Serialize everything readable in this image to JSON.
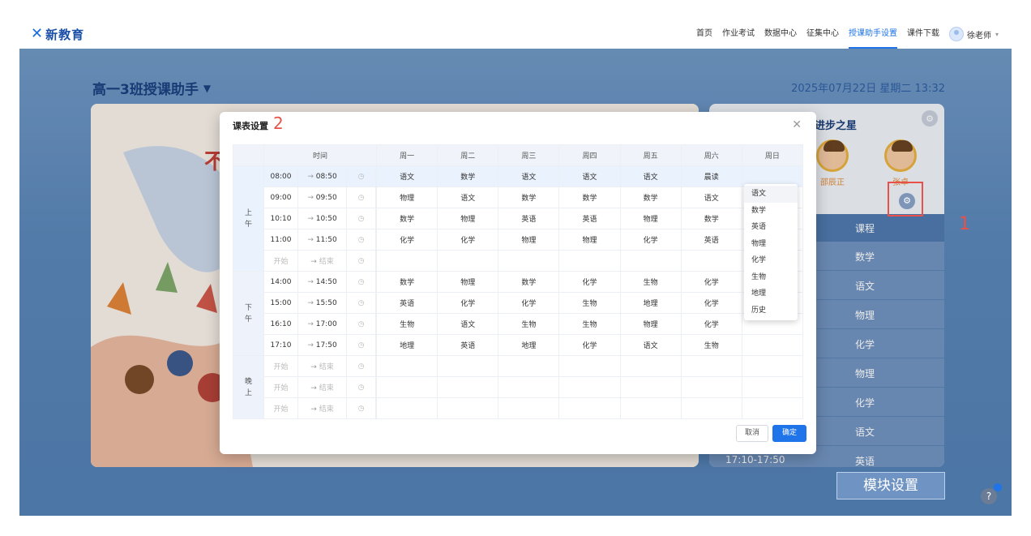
{
  "header": {
    "logo_text": "新教育",
    "nav": [
      "首页",
      "作业考试",
      "数据中心",
      "征集中心",
      "授课助手设置",
      "课件下载"
    ],
    "active_nav": "授课助手设置",
    "user_name": "徐老师"
  },
  "page": {
    "class_title": "高一3班授课助手",
    "datetime": "2025年07月22日 星期二  13:32",
    "star_title": "进步之星",
    "students": [
      "邵辰正",
      "张卓"
    ],
    "schedule_header": "课程",
    "schedule_subjects": [
      "数学",
      "语文",
      "物理",
      "化学",
      "物理",
      "化学",
      "语文",
      "英语"
    ],
    "last_time": "17:10-17:50",
    "module_button": "模块设置",
    "help": "?"
  },
  "annotations": {
    "one": "1",
    "two": "2"
  },
  "modal": {
    "title": "课表设置",
    "headers": {
      "time": "时间",
      "days": [
        "周一",
        "周二",
        "周三",
        "周四",
        "周五",
        "周六",
        "周日"
      ]
    },
    "periods": {
      "morning": "上\n午",
      "afternoon": "下\n午",
      "evening": "晚\n上"
    },
    "rows": [
      {
        "start": "08:00",
        "end": "08:50",
        "cells": [
          "语文",
          "数学",
          "语文",
          "语文",
          "语文",
          "晨读",
          ""
        ]
      },
      {
        "start": "09:00",
        "end": "09:50",
        "cells": [
          "物理",
          "语文",
          "数学",
          "数学",
          "数学",
          "语文",
          ""
        ]
      },
      {
        "start": "10:10",
        "end": "10:50",
        "cells": [
          "数学",
          "物理",
          "英语",
          "英语",
          "物理",
          "数学",
          ""
        ]
      },
      {
        "start": "11:00",
        "end": "11:50",
        "cells": [
          "化学",
          "化学",
          "物理",
          "物理",
          "化学",
          "英语",
          ""
        ]
      },
      {
        "start": "开始",
        "end": "结束",
        "cells": [
          "",
          "",
          "",
          "",
          "",
          "",
          ""
        ],
        "placeholder": true
      },
      {
        "start": "14:00",
        "end": "14:50",
        "cells": [
          "数学",
          "物理",
          "数学",
          "化学",
          "生物",
          "化学",
          ""
        ]
      },
      {
        "start": "15:00",
        "end": "15:50",
        "cells": [
          "英语",
          "化学",
          "化学",
          "生物",
          "地理",
          "化学",
          ""
        ]
      },
      {
        "start": "16:10",
        "end": "17:00",
        "cells": [
          "生物",
          "语文",
          "生物",
          "生物",
          "物理",
          "化学",
          ""
        ]
      },
      {
        "start": "17:10",
        "end": "17:50",
        "cells": [
          "地理",
          "英语",
          "地理",
          "化学",
          "语文",
          "生物",
          ""
        ]
      },
      {
        "start": "开始",
        "end": "结束",
        "cells": [
          "",
          "",
          "",
          "",
          "",
          "",
          ""
        ],
        "placeholder": true
      },
      {
        "start": "开始",
        "end": "结束",
        "cells": [
          "",
          "",
          "",
          "",
          "",
          "",
          ""
        ],
        "placeholder": true
      },
      {
        "start": "开始",
        "end": "结束",
        "cells": [
          "",
          "",
          "",
          "",
          "",
          "",
          ""
        ],
        "placeholder": true
      }
    ],
    "dropdown_options": [
      "语文",
      "数学",
      "英语",
      "物理",
      "化学",
      "生物",
      "地理",
      "历史"
    ],
    "cancel": "取消",
    "ok": "确定"
  },
  "colors": {
    "accent": "#1e74e8",
    "annotation": "#e8514a",
    "bg": "#5b86b8"
  }
}
